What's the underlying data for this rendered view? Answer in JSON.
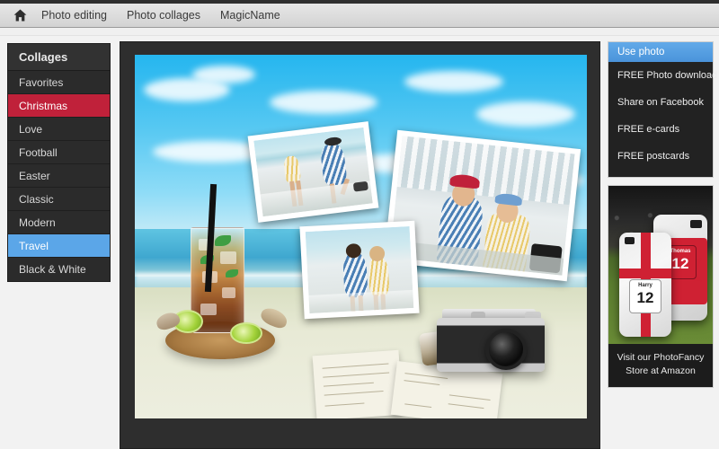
{
  "nav": {
    "home_icon": "home-icon",
    "items": [
      {
        "label": "Photo editing"
      },
      {
        "label": "Photo collages"
      },
      {
        "label": "MagicName"
      }
    ]
  },
  "sidebar": {
    "header": "Collages",
    "items": [
      {
        "label": "Favorites",
        "state": "normal"
      },
      {
        "label": "Christmas",
        "state": "selected-red"
      },
      {
        "label": "Love",
        "state": "normal"
      },
      {
        "label": "Football",
        "state": "normal"
      },
      {
        "label": "Easter",
        "state": "normal"
      },
      {
        "label": "Classic",
        "state": "normal"
      },
      {
        "label": "Modern",
        "state": "normal"
      },
      {
        "label": "Travel",
        "state": "selected-blue"
      },
      {
        "label": "Black & White",
        "state": "normal"
      }
    ]
  },
  "right_panel": {
    "primary_action": "Use photo",
    "links": [
      {
        "label": "FREE Photo download"
      },
      {
        "label": "Share on Facebook"
      },
      {
        "label": "FREE e-cards"
      },
      {
        "label": "FREE postcards"
      }
    ],
    "ad": {
      "caption_line1": "Visit our PhotoFancy",
      "caption_line2": "Store at Amazon",
      "case_front_name": "Harry",
      "case_front_number": "12",
      "case_back_name": "Thomas",
      "case_back_number": "12"
    }
  },
  "colors": {
    "accent_red": "#C0213A",
    "accent_blue": "#5BA6E8",
    "sidebar_bg": "#2B2B2B",
    "stage_bg": "#2E2E2E",
    "navbar_bg": "#DCDCDC"
  }
}
